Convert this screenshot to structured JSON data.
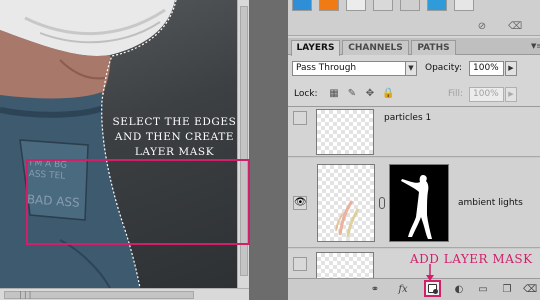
{
  "canvas": {
    "note_lines": [
      "SELECT THE EDGES",
      "AND THEN CREATE",
      "LAYER MASK"
    ],
    "garment_text": [
      "I'M A BG",
      "ASS TEL",
      "BAD ASS"
    ]
  },
  "swatches": {
    "colors": [
      "#2e8fd6",
      "#f07b14",
      "#ececec",
      "#d9d9d9",
      "#cfcfcf",
      "#2f9bd8",
      "#e6e6e6"
    ],
    "icons": [
      "no-icon",
      "trash-icon"
    ]
  },
  "layers_panel": {
    "tabs": [
      {
        "label": "LAYERS",
        "active": true
      },
      {
        "label": "CHANNELS",
        "active": false
      },
      {
        "label": "PATHS",
        "active": false
      }
    ],
    "blend_mode": "Pass Through",
    "opacity_label": "Opacity:",
    "opacity_value": "100%",
    "lock_label": "Lock:",
    "fill_label": "Fill:",
    "fill_value": "100%",
    "layers": [
      {
        "name": "particles 1",
        "visible": false,
        "has_mask": false,
        "selected": false
      },
      {
        "name": "ambient lights",
        "visible": true,
        "has_mask": true,
        "selected": true
      },
      {
        "name": "",
        "visible": false,
        "has_mask": false,
        "selected": false
      }
    ],
    "bottom_icons": [
      "link-icon",
      "fx-icon",
      "add-layer-mask-icon",
      "adjustment-icon",
      "folder-icon",
      "new-layer-icon",
      "trash-icon"
    ]
  },
  "annotation": {
    "callout": "ADD LAYER MASK",
    "accent": "#d11f6a"
  }
}
